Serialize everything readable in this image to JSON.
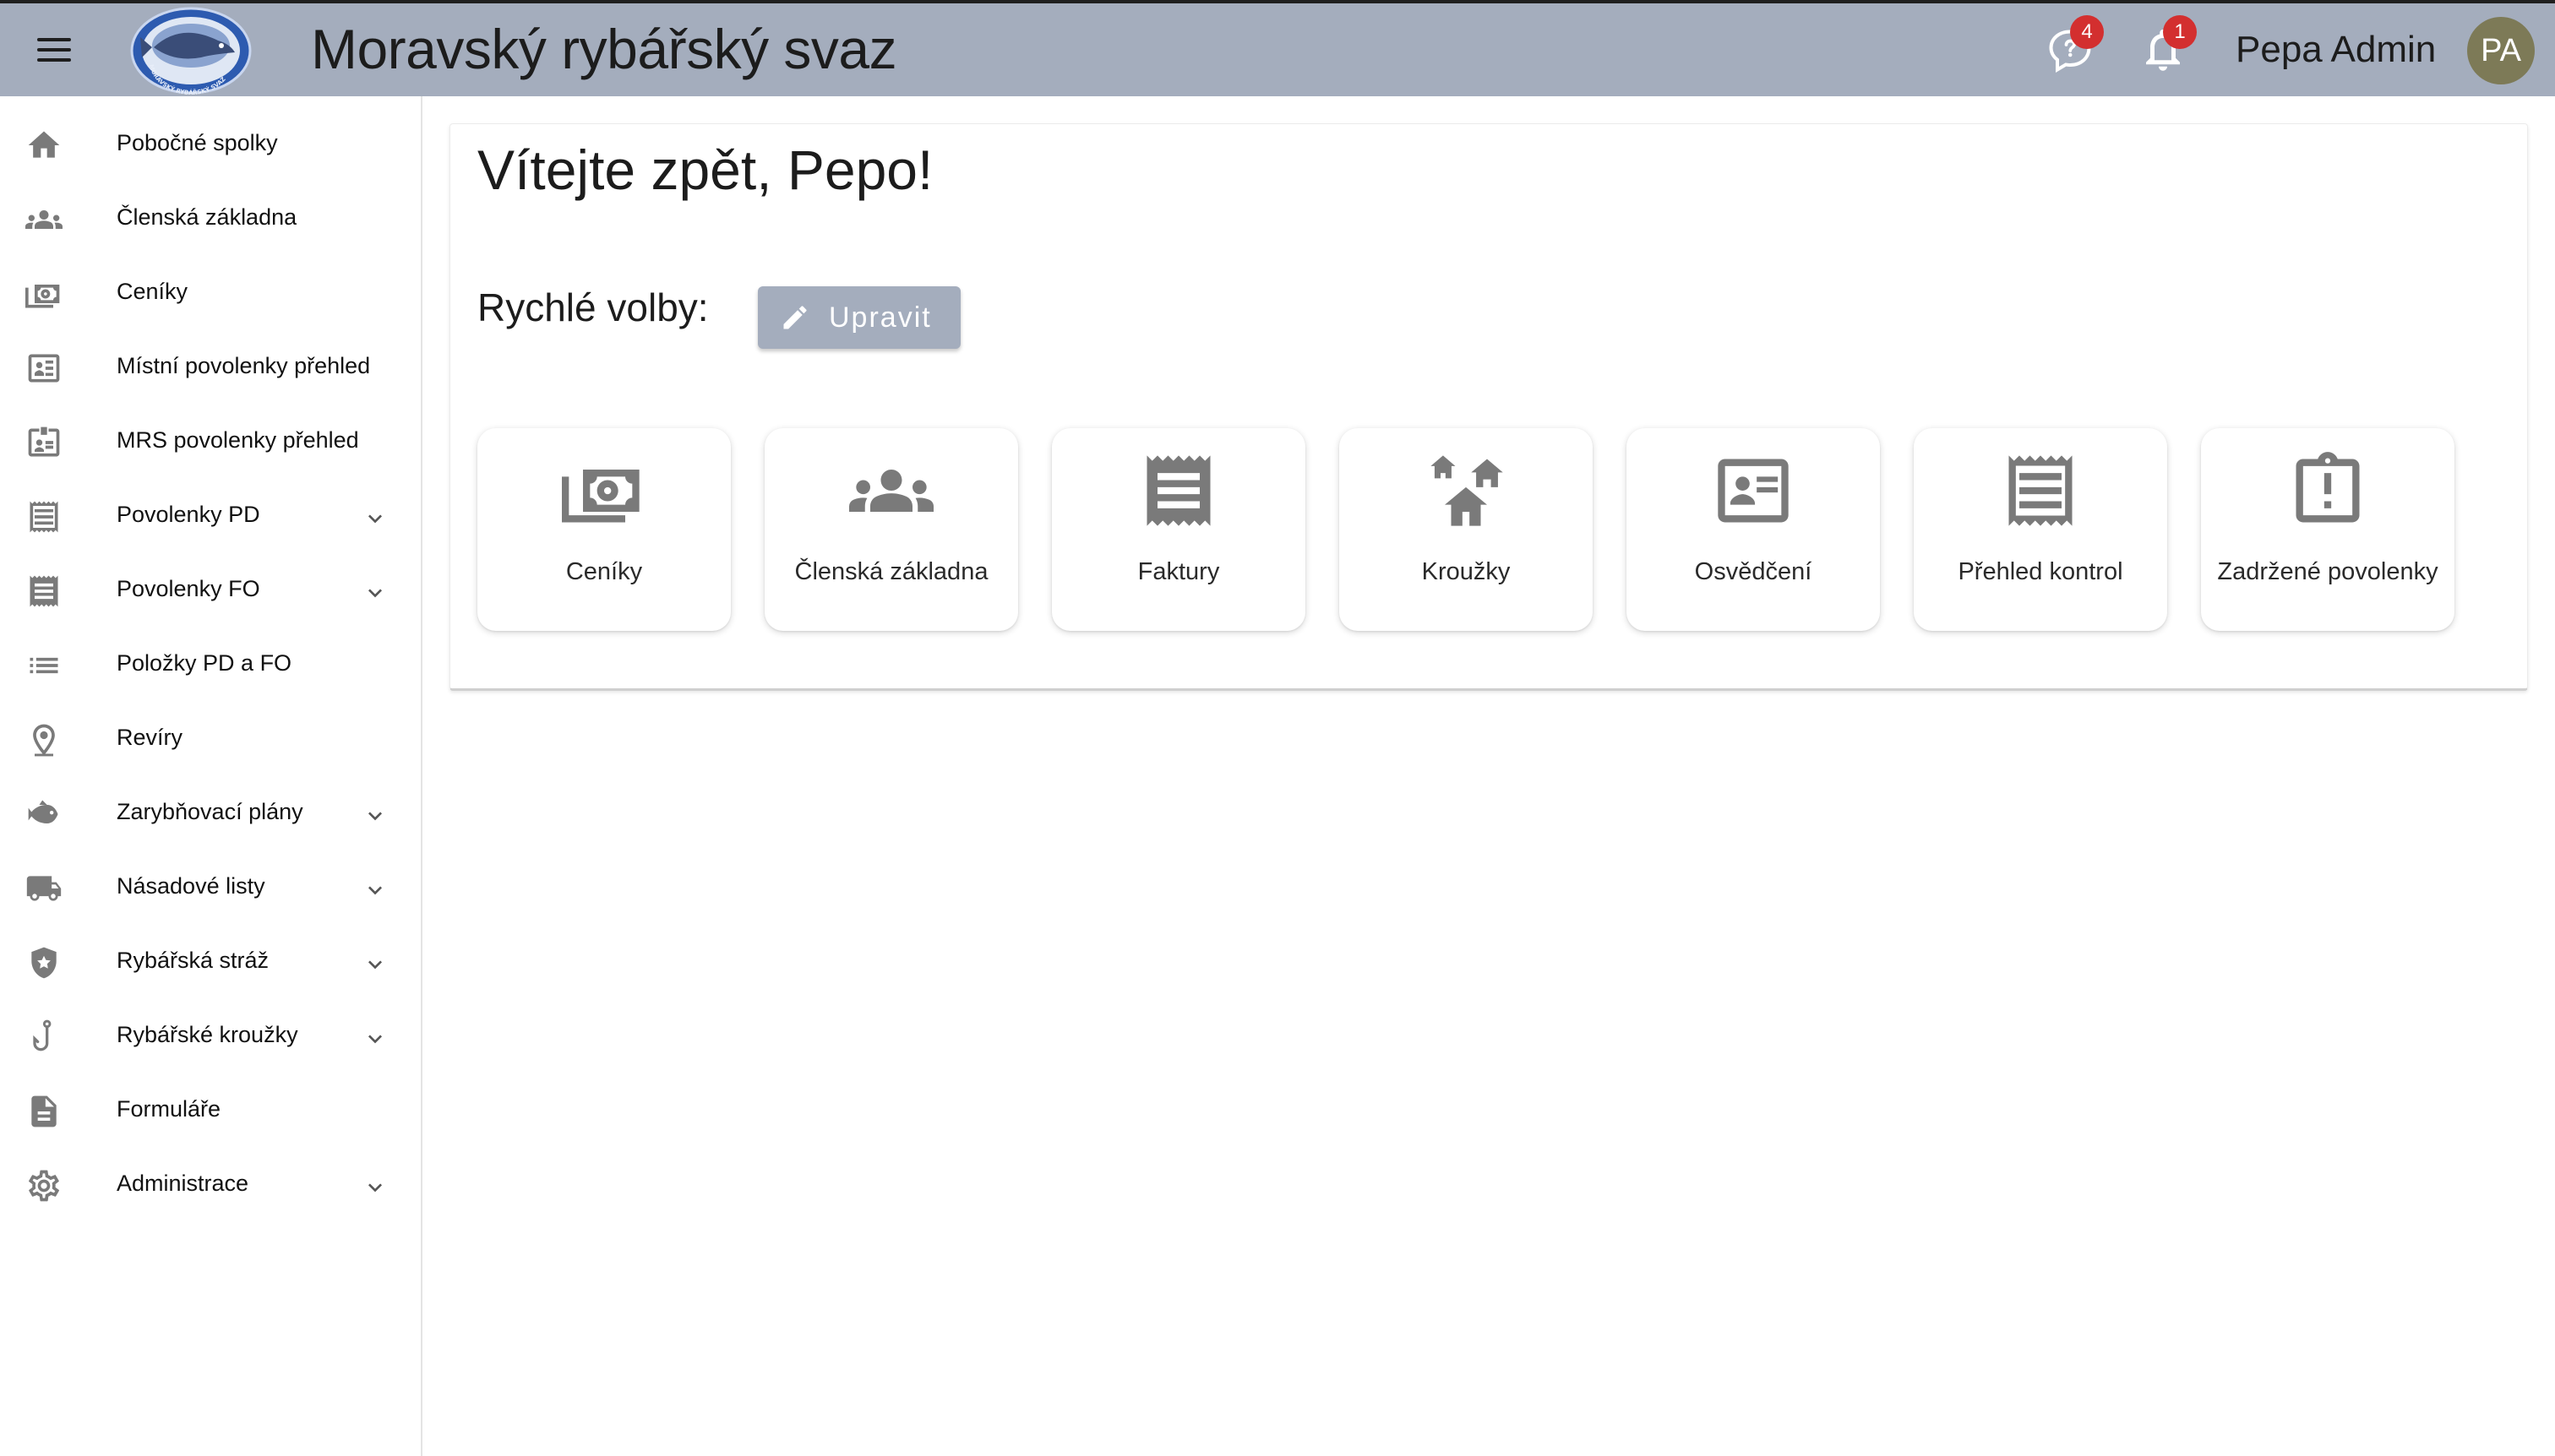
{
  "header": {
    "title": "Moravský rybářský svaz",
    "messages_badge": "4",
    "notifications_badge": "1",
    "user_name": "Pepa Admin",
    "avatar_initials": "PA",
    "logo_text": "MORAVSKÝ RYBÁŘSKÝ SVAZ"
  },
  "sidebar": {
    "items": [
      {
        "label": "Pobočné spolky",
        "icon": "home-icon",
        "expandable": false
      },
      {
        "label": "Členská základna",
        "icon": "people-icon",
        "expandable": false
      },
      {
        "label": "Ceníky",
        "icon": "money-icon",
        "expandable": false
      },
      {
        "label": "Místní povolenky přehled",
        "icon": "id-card-outline-icon",
        "expandable": false
      },
      {
        "label": "MRS povolenky přehled",
        "icon": "id-card-icon",
        "expandable": false
      },
      {
        "label": "Povolenky PD",
        "icon": "receipt-outline-icon",
        "expandable": true
      },
      {
        "label": "Povolenky FO",
        "icon": "receipt-icon",
        "expandable": true
      },
      {
        "label": "Položky PD a FO",
        "icon": "list-icon",
        "expandable": false
      },
      {
        "label": "Revíry",
        "icon": "location-pin-icon",
        "expandable": false
      },
      {
        "label": "Zarybňovací plány",
        "icon": "fish-icon",
        "expandable": true
      },
      {
        "label": "Násadové listy",
        "icon": "truck-icon",
        "expandable": true
      },
      {
        "label": "Rybářská stráž",
        "icon": "police-badge-icon",
        "expandable": true
      },
      {
        "label": "Rybářské kroužky",
        "icon": "hook-icon",
        "expandable": true
      },
      {
        "label": "Formuláře",
        "icon": "document-icon",
        "expandable": false
      },
      {
        "label": "Administrace",
        "icon": "gear-icon",
        "expandable": true
      }
    ]
  },
  "main": {
    "welcome": "Vítejte zpět, Pepo!",
    "quick_label": "Rychlé volby:",
    "edit_button": "Upravit",
    "tiles": [
      {
        "label": "Ceníky",
        "icon": "money-icon"
      },
      {
        "label": "Členská základna",
        "icon": "people-icon"
      },
      {
        "label": "Faktury",
        "icon": "receipt-icon"
      },
      {
        "label": "Kroužky",
        "icon": "houses-icon"
      },
      {
        "label": "Osvědčení",
        "icon": "id-card-outline-icon"
      },
      {
        "label": "Přehled kontrol",
        "icon": "receipt-outline-icon"
      },
      {
        "label": "Zadržené povolenky",
        "icon": "clipboard-alert-icon"
      }
    ]
  },
  "colors": {
    "header_bg": "#a4adbd",
    "icon_gray": "#7a7a7a",
    "badge_red": "#d32f2f",
    "avatar_bg": "#7d7a57"
  }
}
